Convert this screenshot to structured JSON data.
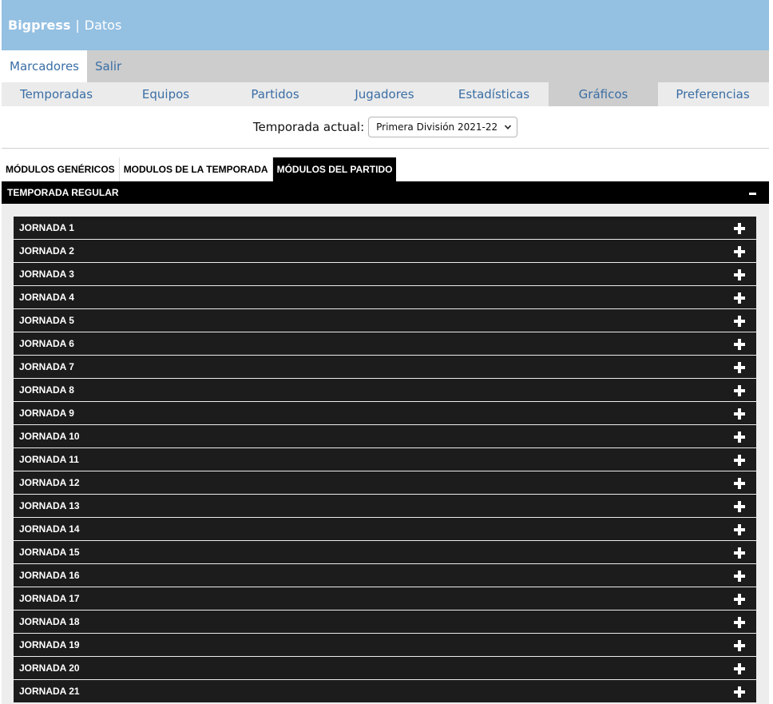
{
  "header": {
    "brand": "Bigpress",
    "separator": "|",
    "section": "Datos"
  },
  "topnav": {
    "items": [
      "Marcadores",
      "Salir"
    ],
    "active": 0
  },
  "subnav": {
    "items": [
      "Temporadas",
      "Equipos",
      "Partidos",
      "Jugadores",
      "Estadísticas",
      "Gráficos",
      "Preferencias"
    ],
    "active": 5
  },
  "season": {
    "label": "Temporada actual:",
    "selected": "Primera División 2021-22"
  },
  "module_tabs": {
    "items": [
      "MÓDULOS GENÉRICOS",
      "MODULOS DE LA TEMPORADA",
      "MÓDULOS DEL PARTIDO"
    ],
    "active": 2
  },
  "section": {
    "title": "TEMPORADA REGULAR",
    "toggle": "-"
  },
  "rounds": [
    "JORNADA 1",
    "JORNADA 2",
    "JORNADA 3",
    "JORNADA 4",
    "JORNADA 5",
    "JORNADA 6",
    "JORNADA 7",
    "JORNADA 8",
    "JORNADA 9",
    "JORNADA 10",
    "JORNADA 11",
    "JORNADA 12",
    "JORNADA 13",
    "JORNADA 14",
    "JORNADA 15",
    "JORNADA 16",
    "JORNADA 17",
    "JORNADA 18",
    "JORNADA 19",
    "JORNADA 20",
    "JORNADA 21"
  ],
  "icons": {
    "round_toggle": "plus-icon",
    "section_toggle": "minus-icon",
    "select_arrow": "chevron-down-icon"
  },
  "colors": {
    "header_bg": "#94c0e2",
    "nav_bg": "#cdcdcd",
    "link": "#3a6ea5",
    "bar_bg": "#000000",
    "row_bg": "#1c1c1c"
  }
}
